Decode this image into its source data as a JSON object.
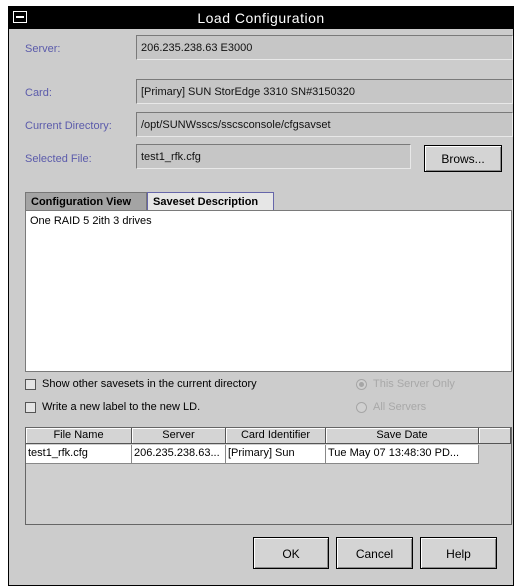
{
  "window": {
    "title": "Load Configuration"
  },
  "form": {
    "server_label": "Server:",
    "server_value": "206.235.238.63 E3000",
    "card_label": "Card:",
    "card_value": "[Primary] SUN StorEdge 3310 SN#3150320",
    "directory_label": "Current Directory:",
    "directory_value": "/opt/SUNWsscs/sscsconsole/cfgsavset",
    "file_label": "Selected File:",
    "file_value": "test1_rfk.cfg",
    "browse_label": "Brows..."
  },
  "tabs": [
    {
      "label": "Configuration View",
      "active": true
    },
    {
      "label": "Saveset Description",
      "active": false
    }
  ],
  "description_text": "One RAID 5 2ith 3 drives",
  "options": {
    "show_other_label": "Show other savesets in the current directory",
    "show_other_checked": false,
    "write_label_label": "Write a new label to the new LD.",
    "write_label_checked": false,
    "this_server_label": "This Server Only",
    "all_servers_label": "All Servers",
    "selected_radio": "This Server Only"
  },
  "table": {
    "columns": [
      "File Name",
      "Server",
      "Card Identifier",
      "Save Date"
    ],
    "rows": [
      [
        "test1_rfk.cfg",
        "206.235.238.63...",
        "[Primary] Sun",
        "Tue May 07 13:48:30 PD..."
      ]
    ]
  },
  "buttons": {
    "ok": "OK",
    "cancel": "Cancel",
    "help": "Help"
  },
  "colors": {
    "label": "#5b5bab",
    "dialog_bg": "#cccccc",
    "titlebar": "#000000"
  }
}
